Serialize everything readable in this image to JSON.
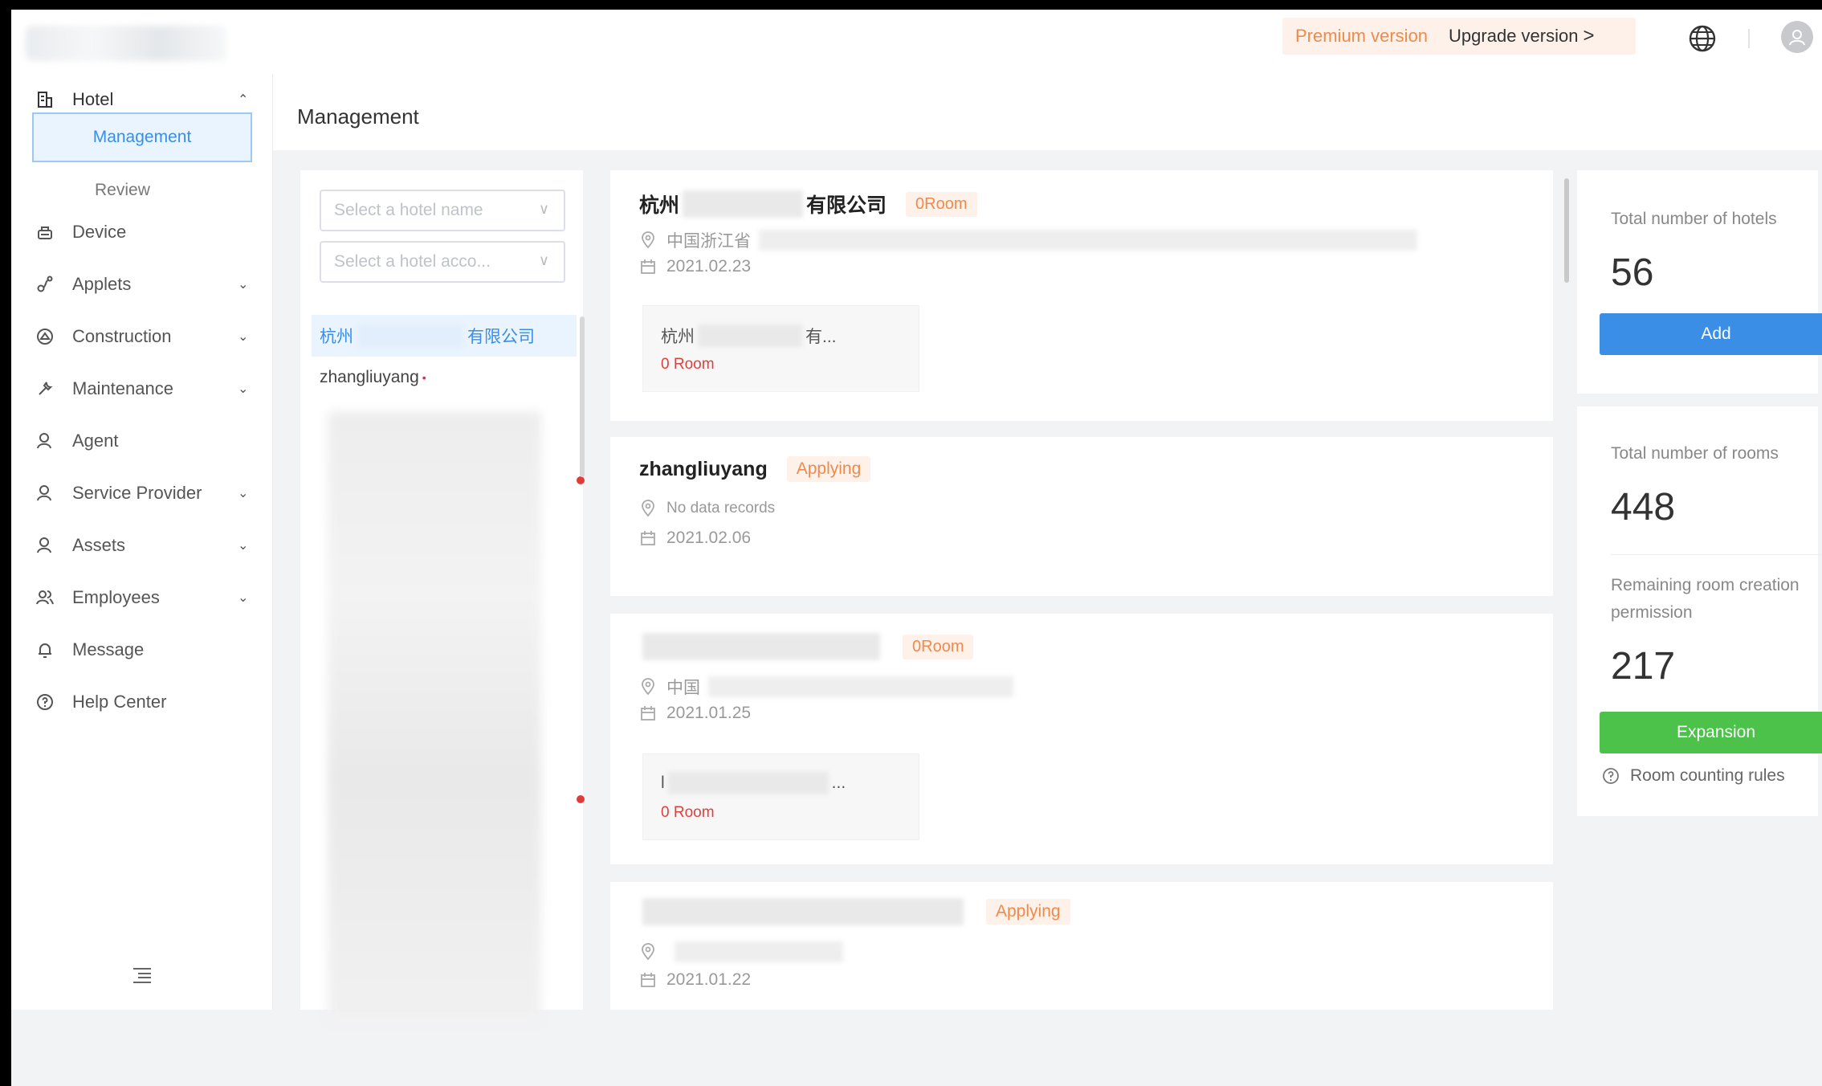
{
  "header": {
    "premium_label": "Premium version",
    "upgrade_label": "Upgrade version",
    "upgrade_arrow": ">"
  },
  "page_title": "Management",
  "sidebar": {
    "items": [
      {
        "label": "Hotel",
        "icon": "building-icon",
        "expanded": true
      },
      {
        "label": "Device",
        "icon": "device-icon"
      },
      {
        "label": "Applets",
        "icon": "applet-icon"
      },
      {
        "label": "Construction",
        "icon": "construction-icon"
      },
      {
        "label": "Maintenance",
        "icon": "wrench-icon"
      },
      {
        "label": "Agent",
        "icon": "user-icon"
      },
      {
        "label": "Service Provider",
        "icon": "user-icon"
      },
      {
        "label": "Assets",
        "icon": "user-icon"
      },
      {
        "label": "Employees",
        "icon": "users-icon"
      },
      {
        "label": "Message",
        "icon": "bell-icon"
      },
      {
        "label": "Help Center",
        "icon": "question-icon"
      }
    ],
    "sub_items": [
      {
        "label": "Management",
        "active": true
      },
      {
        "label": "Review"
      }
    ]
  },
  "filters": {
    "hotel_name_placeholder": "Select a hotel name",
    "hotel_account_placeholder": "Select a hotel acco..."
  },
  "hotel_list": [
    {
      "prefix": "杭州",
      "suffix": "有限公司",
      "active": true
    },
    {
      "name": "zhangliuyang",
      "unread": "•"
    }
  ],
  "cards": [
    {
      "title_prefix": "杭州",
      "title_suffix": "有限公司",
      "badge": "0Room",
      "location": "中国浙江省",
      "date": "2021.02.23",
      "room_box": {
        "name_prefix": "杭州",
        "name_suffix": "有...",
        "count": "0 Room"
      }
    },
    {
      "title": "zhangliuyang",
      "badge": "Applying",
      "location": "No data records",
      "date": "2021.02.06"
    },
    {
      "badge": "0Room",
      "location": "中国",
      "date": "2021.01.25",
      "room_box": {
        "name_prefix": "l",
        "name_suffix": "...",
        "count": "0 Room"
      }
    },
    {
      "badge": "Applying",
      "location": "",
      "date": "2021.01.22"
    }
  ],
  "stats": {
    "hotels_label": "Total number of hotels",
    "hotels_value": "56",
    "add_label": "Add",
    "rooms_label": "Total number of rooms",
    "rooms_value": "448",
    "remaining_label": "Remaining room creation permission",
    "remaining_value": "217",
    "expansion_label": "Expansion",
    "rules_label": "Room counting rules"
  },
  "colors": {
    "accent": "#3a8ee6",
    "success": "#4cc24a",
    "warning": "#f08a4b",
    "danger": "#e0403b"
  }
}
